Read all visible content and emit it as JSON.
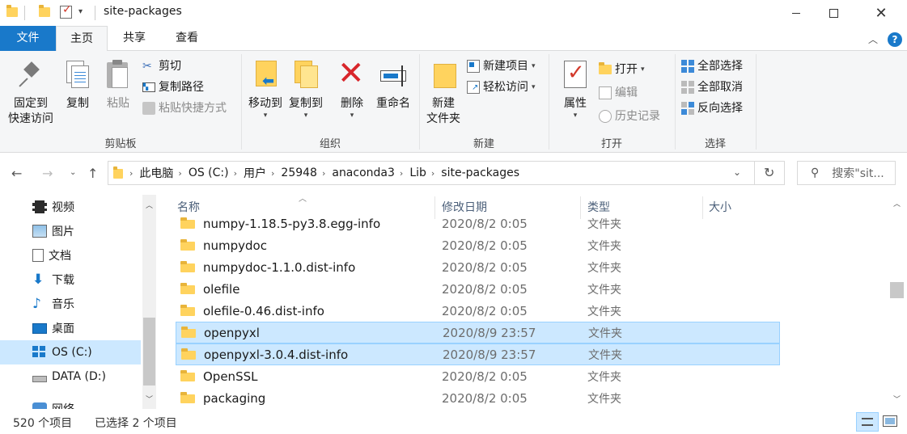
{
  "window": {
    "title": "site-packages"
  },
  "tabs": [
    "文件",
    "主页",
    "共享",
    "查看"
  ],
  "ribbon": {
    "clipboard": {
      "pin_label_1": "固定到",
      "pin_label_2": "快速访问",
      "copy": "复制",
      "paste": "粘贴",
      "cut": "剪切",
      "copy_path": "复制路径",
      "paste_shortcut": "粘贴快捷方式",
      "group": "剪贴板"
    },
    "organize": {
      "move_to": "移动到",
      "copy_to": "复制到",
      "delete": "删除",
      "rename": "重命名",
      "group": "组织"
    },
    "new": {
      "new_folder_1": "新建",
      "new_folder_2": "文件夹",
      "new_item": "新建项目",
      "easy_access": "轻松访问",
      "group": "新建"
    },
    "open": {
      "properties": "属性",
      "open": "打开",
      "edit": "编辑",
      "history": "历史记录",
      "group": "打开"
    },
    "select": {
      "select_all": "全部选择",
      "select_none": "全部取消",
      "invert": "反向选择",
      "group": "选择"
    }
  },
  "address": {
    "crumbs": [
      "此电脑",
      "OS (C:)",
      "用户",
      "25948",
      "anaconda3",
      "Lib",
      "site-packages"
    ],
    "search_placeholder": "搜索\"sit..."
  },
  "navpane": {
    "items": [
      {
        "label": "视频",
        "icon": "video-icon"
      },
      {
        "label": "图片",
        "icon": "pictures-icon"
      },
      {
        "label": "文档",
        "icon": "documents-icon"
      },
      {
        "label": "下载",
        "icon": "download-icon"
      },
      {
        "label": "音乐",
        "icon": "music-icon"
      },
      {
        "label": "桌面",
        "icon": "desktop-icon"
      },
      {
        "label": "OS (C:)",
        "icon": "drive-os-icon"
      },
      {
        "label": "DATA (D:)",
        "icon": "drive-icon"
      },
      {
        "label": "网络",
        "icon": "network-icon"
      }
    ]
  },
  "columns": {
    "name": "名称",
    "date": "修改日期",
    "type": "类型",
    "size": "大小"
  },
  "files": [
    {
      "name": "numpy-1.18.5-py3.8.egg-info",
      "date": "2020/8/2 0:05",
      "type": "文件夹",
      "selected": false
    },
    {
      "name": "numpydoc",
      "date": "2020/8/2 0:05",
      "type": "文件夹",
      "selected": false
    },
    {
      "name": "numpydoc-1.1.0.dist-info",
      "date": "2020/8/2 0:05",
      "type": "文件夹",
      "selected": false
    },
    {
      "name": "olefile",
      "date": "2020/8/2 0:05",
      "type": "文件夹",
      "selected": false
    },
    {
      "name": "olefile-0.46.dist-info",
      "date": "2020/8/2 0:05",
      "type": "文件夹",
      "selected": false
    },
    {
      "name": "openpyxl",
      "date": "2020/8/9 23:57",
      "type": "文件夹",
      "selected": true
    },
    {
      "name": "openpyxl-3.0.4.dist-info",
      "date": "2020/8/9 23:57",
      "type": "文件夹",
      "selected": true
    },
    {
      "name": "OpenSSL",
      "date": "2020/8/2 0:05",
      "type": "文件夹",
      "selected": false
    },
    {
      "name": "packaging",
      "date": "2020/8/2 0:05",
      "type": "文件夹",
      "selected": false
    }
  ],
  "status": {
    "count": "520 个项目",
    "selected": "已选择 2 个项目"
  },
  "colors": {
    "file_tab": "#1979ca",
    "selection": "#cce8ff",
    "selection_border": "#99d1ff",
    "folder": "#ffd35e"
  }
}
